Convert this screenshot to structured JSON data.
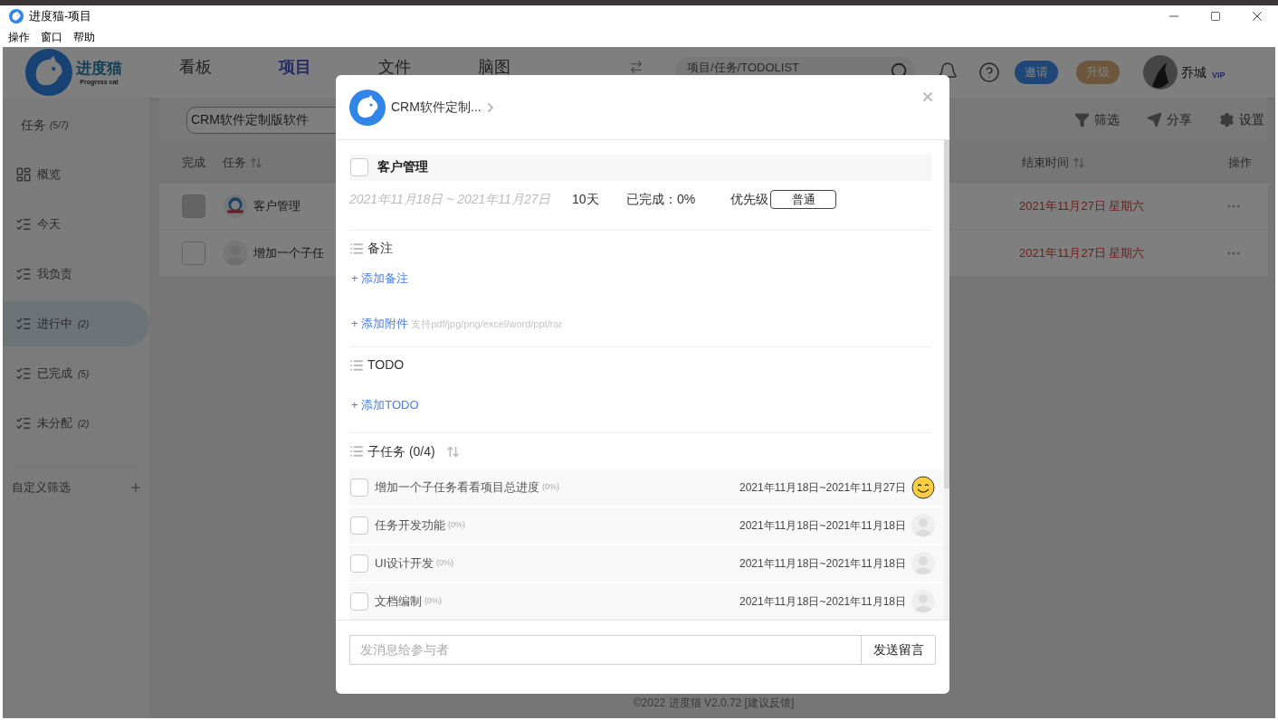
{
  "window": {
    "title": "进度猫-项目",
    "menu": [
      "操作",
      "窗口",
      "帮助"
    ]
  },
  "header": {
    "logo_text": "进度猫",
    "logo_subtext": "Progress cat",
    "nav": [
      {
        "label": "看板",
        "selected": false
      },
      {
        "label": "项目",
        "selected": true
      },
      {
        "label": "文件",
        "selected": false
      },
      {
        "label": "脑图",
        "selected": false
      }
    ],
    "search": {
      "placeholder": "项目/任务/TODOLIST"
    },
    "buttons": [
      {
        "label": "邀请",
        "kind": "invite"
      },
      {
        "label": "升级",
        "kind": "upgrade"
      }
    ],
    "user": {
      "name": "乔城",
      "badge": "VIP"
    }
  },
  "sidebar": {
    "title": "任务",
    "count": "(5/7)",
    "items": [
      {
        "label": "概览",
        "kind": "overview",
        "selected": false
      },
      {
        "label": "今天",
        "kind": "list",
        "selected": false
      },
      {
        "label": "我负责",
        "kind": "list",
        "selected": false
      },
      {
        "label": "进行中",
        "count": "(2)",
        "kind": "list",
        "selected": true
      },
      {
        "label": "已完成",
        "count": "(5)",
        "kind": "list",
        "selected": false
      },
      {
        "label": "未分配",
        "count": "(2)",
        "kind": "list",
        "selected": false
      }
    ],
    "custom_filter": "自定义筛选"
  },
  "toolbar": {
    "project": "CRM软件定制版软件",
    "actions": [
      {
        "label": "筛选",
        "kind": "filter"
      },
      {
        "label": "分享",
        "kind": "share"
      },
      {
        "label": "设置",
        "kind": "settings"
      }
    ]
  },
  "table": {
    "columns": [
      {
        "label": "完成",
        "sortable": false
      },
      {
        "label": "任务",
        "sortable": true
      },
      {
        "label": "结束时间",
        "sortable": true
      },
      {
        "label": "操作",
        "sortable": false
      }
    ],
    "rows": [
      {
        "disabled": true,
        "avatar": {
          "kind": "emblem"
        },
        "task": "客户管理",
        "end_date": "2021年11月27日 星期六"
      },
      {
        "disabled": false,
        "avatar": {
          "kind": "placeholder"
        },
        "task": "增加一个子任",
        "end_date": "2021年11月27日 星期六"
      }
    ]
  },
  "footer": "©2022 进度猫 V2.0.72  [建议反馈]",
  "dialog": {
    "breadcrumb": "CRM软件定制...",
    "task": {
      "title": "客户管理",
      "checked": false
    },
    "dates": "2021年11月18日 ~ 2021年11月27日",
    "duration": "10天",
    "progress": "已完成：0%",
    "priority_label": "优先级",
    "priority": "普通",
    "notes": {
      "heading": "备注",
      "add": "+ 添加备注",
      "attach": "+ 添加附件",
      "attach_hint": "支持pdf/jpg/png/excel/word/ppt/rar"
    },
    "todo": {
      "heading": "TODO",
      "add": "+ 添加TODO"
    },
    "subtasks": {
      "heading": "子任务 (0/4)",
      "items": [
        {
          "name": "增加一个子任务看看项目总进度",
          "progress": "(0%)",
          "dates": "2021年11月18日~2021年11月27日",
          "checked": false,
          "avatar": {
            "kind": "smiley"
          }
        },
        {
          "name": "任务开发功能",
          "progress": "(0%)",
          "dates": "2021年11月18日~2021年11月18日",
          "checked": false,
          "avatar": {
            "kind": "placeholder"
          }
        },
        {
          "name": "UI设计开发",
          "progress": "(0%)",
          "dates": "2021年11月18日~2021年11月18日",
          "checked": false,
          "avatar": {
            "kind": "placeholder"
          }
        },
        {
          "name": "文档编制",
          "progress": "(0%)",
          "dates": "2021年11月18日~2021年11月18日",
          "checked": false,
          "avatar": {
            "kind": "placeholder"
          }
        }
      ]
    },
    "message": {
      "placeholder": "发消息给参与者",
      "send": "发送留言"
    }
  }
}
